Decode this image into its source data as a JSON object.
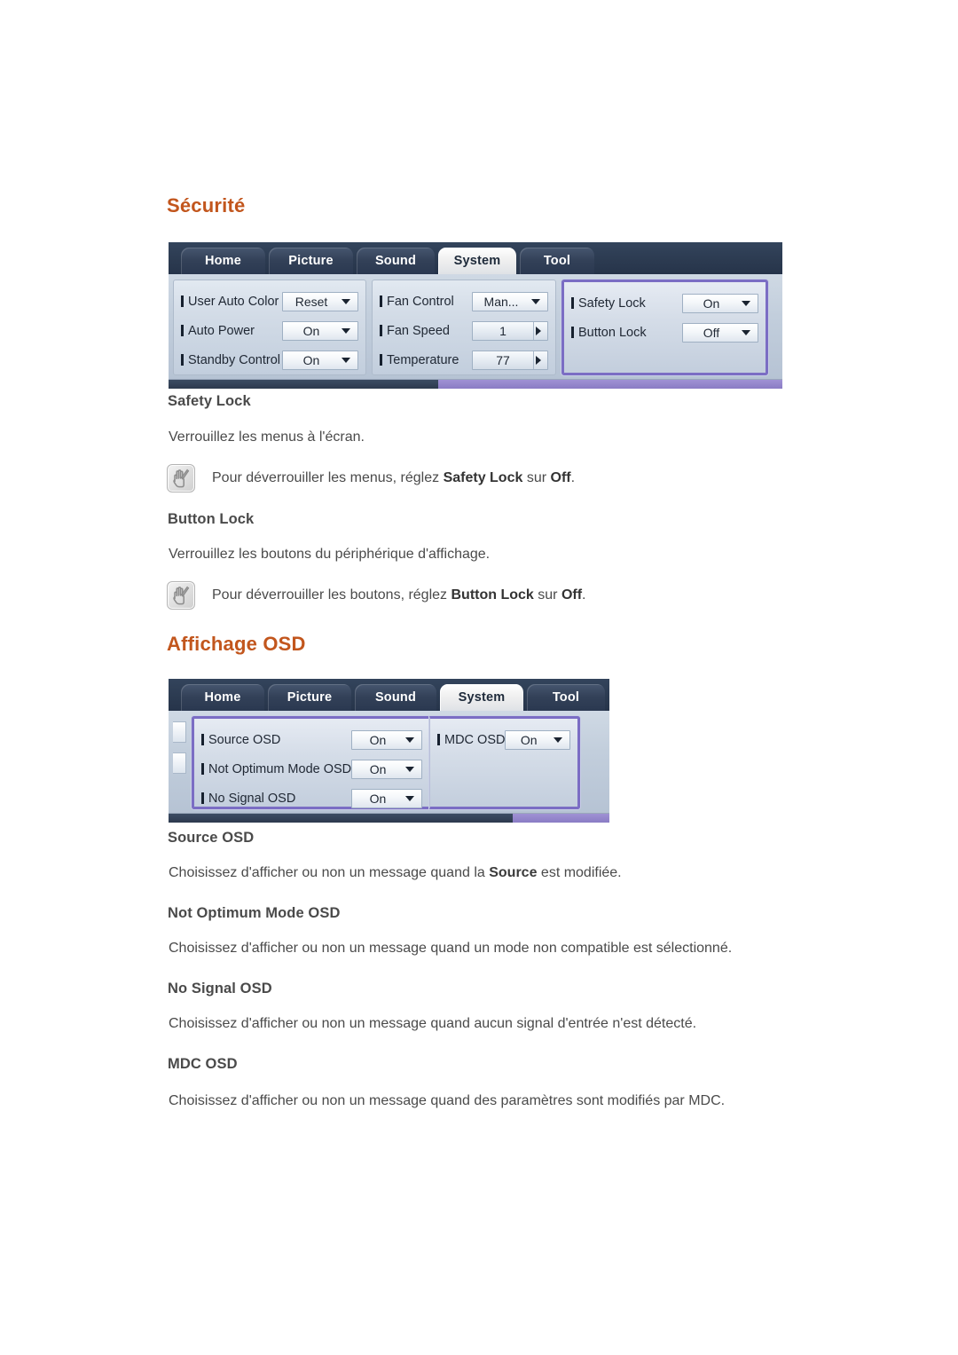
{
  "sections": [
    {
      "id": "securite",
      "title": "Sécurité"
    },
    {
      "id": "affichage-osd",
      "title": "Affichage OSD"
    }
  ],
  "osd_security": {
    "tabs": [
      {
        "label": "Home",
        "active": false
      },
      {
        "label": "Picture",
        "active": false
      },
      {
        "label": "Sound",
        "active": false
      },
      {
        "label": "System",
        "active": true
      },
      {
        "label": "Tool",
        "active": false
      }
    ],
    "panels": [
      {
        "highlighted": false,
        "rows": [
          {
            "label": "User Auto Color",
            "value": "Reset",
            "control": "dropdown"
          },
          {
            "label": "Auto Power",
            "value": "On",
            "control": "dropdown"
          },
          {
            "label": "Standby Control",
            "value": "On",
            "control": "dropdown"
          }
        ]
      },
      {
        "highlighted": false,
        "rows": [
          {
            "label": "Fan Control",
            "value": "Man...",
            "control": "dropdown"
          },
          {
            "label": "Fan Speed",
            "value": "1",
            "control": "stepper"
          },
          {
            "label": "Temperature",
            "value": "77",
            "control": "stepper"
          }
        ]
      },
      {
        "highlighted": true,
        "rows": [
          {
            "label": "Safety Lock",
            "value": "On",
            "control": "dropdown"
          },
          {
            "label": "Button Lock",
            "value": "Off",
            "control": "dropdown"
          }
        ]
      }
    ]
  },
  "osd_display": {
    "tabs": [
      {
        "label": "Home",
        "active": false
      },
      {
        "label": "Picture",
        "active": false
      },
      {
        "label": "Sound",
        "active": false
      },
      {
        "label": "System",
        "active": true
      },
      {
        "label": "Tool",
        "active": false
      }
    ],
    "panels": [
      {
        "highlighted": true,
        "rows": [
          {
            "label": "Source OSD",
            "value": "On",
            "control": "dropdown"
          },
          {
            "label": "Not Optimum Mode OSD",
            "value": "On",
            "control": "dropdown"
          },
          {
            "label": "No Signal OSD",
            "value": "On",
            "control": "dropdown"
          }
        ]
      },
      {
        "highlighted": true,
        "rows": [
          {
            "label": "MDC OSD",
            "value": "On",
            "control": "dropdown"
          }
        ]
      }
    ]
  },
  "content": {
    "safety_lock_head": "Safety Lock",
    "safety_lock_body": "Verrouillez les menus à l'écran.",
    "safety_lock_note_pre": "Pour déverrouiller les menus, réglez ",
    "safety_lock_note_b1": "Safety Lock",
    "safety_lock_note_mid": " sur ",
    "safety_lock_note_b2": "Off",
    "safety_lock_note_post": ".",
    "button_lock_head": "Button Lock",
    "button_lock_body": "Verrouillez les boutons du périphérique d'affichage.",
    "button_lock_note_pre": "Pour déverrouiller les boutons, réglez ",
    "button_lock_note_b1": "Button Lock",
    "button_lock_note_mid": " sur ",
    "button_lock_note_b2": "Off",
    "button_lock_note_post": ".",
    "source_osd_head": "Source OSD",
    "source_osd_body_pre": "Choisissez d'afficher ou non un message quand la ",
    "source_osd_body_b": "Source",
    "source_osd_body_post": " est modifiée.",
    "not_optimum_head": "Not Optimum Mode OSD",
    "not_optimum_body": "Choisissez d'afficher ou non un message quand un mode non compatible est sélectionné.",
    "no_signal_head": "No Signal OSD",
    "no_signal_body": "Choisissez d'afficher ou non un message quand aucun signal d'entrée n'est détecté.",
    "mdc_osd_head": "MDC OSD",
    "mdc_osd_body": "Choisissez d'afficher ou non un message quand des paramètres sont modifiés par MDC."
  },
  "colors": {
    "heading": "#c2561d",
    "body_text": "#4a4a4a",
    "osd_tabbar": "#2d3c50",
    "osd_highlight": "#7b6dc4"
  }
}
